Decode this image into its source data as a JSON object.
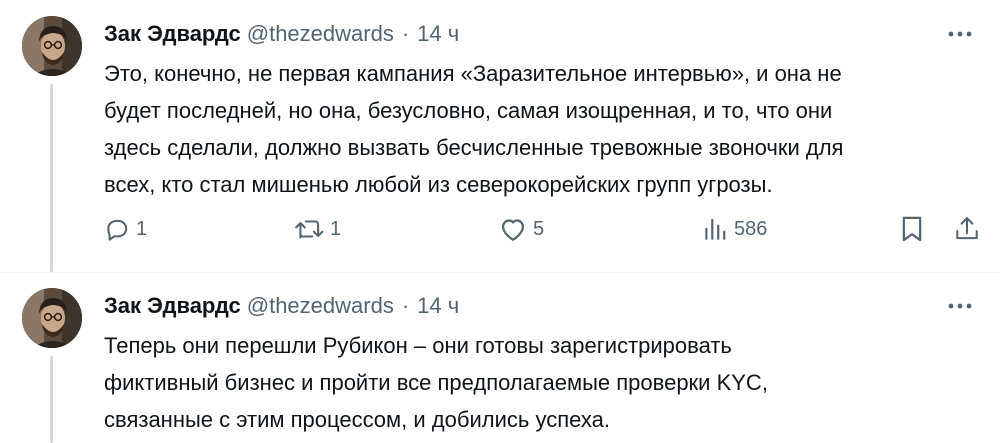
{
  "tweets": [
    {
      "author": "Зак Эдвардс",
      "handle": "@thezedwards",
      "separator": "·",
      "time": "14 ч",
      "lines": [
        "Это, конечно, не первая кампания «Заразительное интервью», и она не",
        "будет последней, но она, безусловно, самая изощренная, и то, что они",
        "здесь сделали, должно вызвать бесчисленные тревожные звоночки для",
        "всех, кто стал мишенью любой из северокорейских групп угрозы."
      ],
      "actions": {
        "replies": "1",
        "retweets": "1",
        "likes": "5",
        "views": "586"
      }
    },
    {
      "author": "Зак Эдвардс",
      "handle": "@thezedwards",
      "separator": "·",
      "time": "14 ч",
      "lines": [
        "Теперь они перешли Рубикон – они готовы зарегистрировать",
        "фиктивный бизнес и пройти все предполагаемые проверки KYC,",
        "связанные с этим процессом, и добились успеха."
      ]
    }
  ],
  "icons": {
    "more": "more-icon",
    "reply": "reply-icon",
    "retweet": "retweet-icon",
    "like": "like-icon",
    "views": "views-icon",
    "bookmark": "bookmark-icon",
    "share": "share-icon"
  },
  "colors": {
    "text": "#0f1419",
    "secondary": "#536471",
    "divider": "#eff3f4",
    "thread_line": "#cfd9de"
  }
}
